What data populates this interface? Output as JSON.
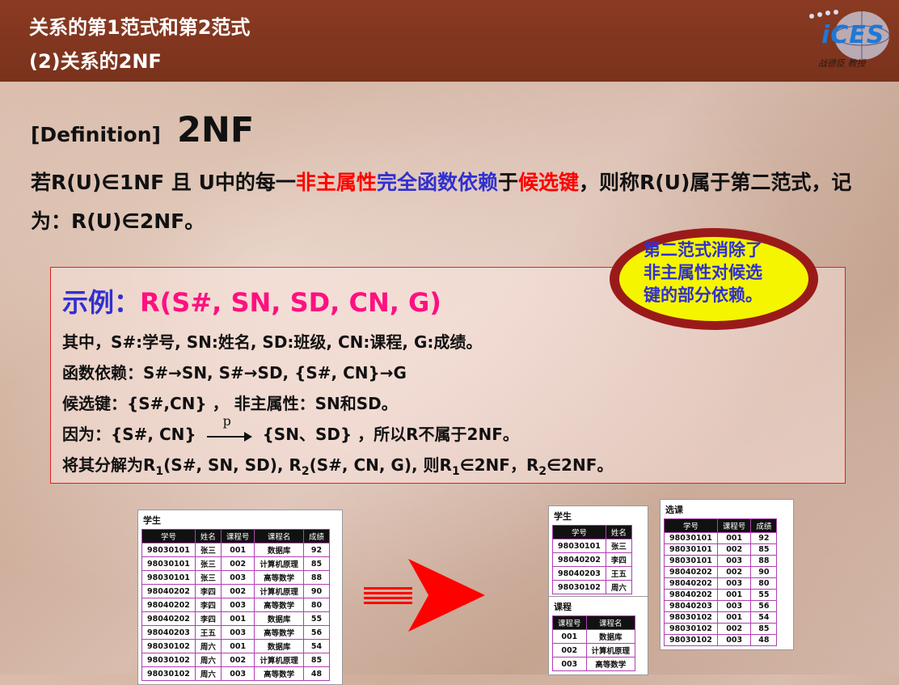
{
  "header": {
    "title_line1": "关系的第1范式和第2范式",
    "title_line2": "(2)关系的2NF",
    "logo_text": "iCES",
    "logo_author": "战德臣 教授",
    "bg_color": "#7a321c"
  },
  "definition": {
    "label": "[Definition]",
    "term": "2NF",
    "p1": "若R(U)∈1NF 且 U中的每一",
    "p2_red": "非主属性",
    "p3_blue": "完全函数依赖",
    "p4": "于",
    "p5_red": "候选键",
    "p6": "，则称R(U)属于第二范式，记为：R(U)∈2NF。"
  },
  "callout": {
    "line1": "第二范式消除了",
    "line2": "非主属性对候选",
    "line3": "键的部分依赖。"
  },
  "example": {
    "label": "示例：",
    "relation": "R(S#, SN, SD, CN, G)",
    "line1": "其中，S#:学号, SN:姓名, SD:班级, CN:课程, G:成绩。",
    "line2": "函数依赖：S#→SN,  S#→SD, {S#, CN}→G",
    "line3": "候选键：{S#,CN} ， 非主属性：SN和SD。",
    "line4_a": "因为：{S#, CN}",
    "line4_p": "p",
    "line4_b": "{SN、SD} ，所以R不属于2NF。",
    "line5_a": "将其分解为R",
    "line5_s1": "1",
    "line5_b": "(S#, SN, SD), R",
    "line5_s2": "2",
    "line5_c": "(S#, CN, G), 则R",
    "line5_s3": "1",
    "line5_d": "∈2NF，R",
    "line5_s4": "2",
    "line5_e": "∈2NF。"
  },
  "tables": {
    "student_full": {
      "caption": "学生",
      "headers": [
        "学号",
        "姓名",
        "课程号",
        "课程名",
        "成绩"
      ],
      "rows": [
        [
          "98030101",
          "张三",
          "001",
          "数据库",
          "92"
        ],
        [
          "98030101",
          "张三",
          "002",
          "计算机原理",
          "85"
        ],
        [
          "98030101",
          "张三",
          "003",
          "高等数学",
          "88"
        ],
        [
          "98040202",
          "李四",
          "002",
          "计算机原理",
          "90"
        ],
        [
          "98040202",
          "李四",
          "003",
          "高等数学",
          "80"
        ],
        [
          "98040202",
          "李四",
          "001",
          "数据库",
          "55"
        ],
        [
          "98040203",
          "王五",
          "003",
          "高等数学",
          "56"
        ],
        [
          "98030102",
          "周六",
          "001",
          "数据库",
          "54"
        ],
        [
          "98030102",
          "周六",
          "002",
          "计算机原理",
          "85"
        ],
        [
          "98030102",
          "周六",
          "003",
          "高等数学",
          "48"
        ]
      ]
    },
    "student": {
      "caption": "学生",
      "headers": [
        "学号",
        "姓名"
      ],
      "rows": [
        [
          "98030101",
          "张三"
        ],
        [
          "98040202",
          "李四"
        ],
        [
          "98040203",
          "王五"
        ],
        [
          "98030102",
          "周六"
        ]
      ]
    },
    "course": {
      "caption": "课程",
      "headers": [
        "课程号",
        "课程名"
      ],
      "rows": [
        [
          "001",
          "数据库"
        ],
        [
          "002",
          "计算机原理"
        ],
        [
          "003",
          "高等数学"
        ]
      ]
    },
    "enroll": {
      "caption": "选课",
      "headers": [
        "学号",
        "课程号",
        "成绩"
      ],
      "rows": [
        [
          "98030101",
          "001",
          "92"
        ],
        [
          "98030101",
          "002",
          "85"
        ],
        [
          "98030101",
          "003",
          "88"
        ],
        [
          "98040202",
          "002",
          "90"
        ],
        [
          "98040202",
          "003",
          "80"
        ],
        [
          "98040202",
          "001",
          "55"
        ],
        [
          "98040203",
          "003",
          "56"
        ],
        [
          "98030102",
          "001",
          "54"
        ],
        [
          "98030102",
          "002",
          "85"
        ],
        [
          "98030102",
          "003",
          "48"
        ]
      ]
    }
  }
}
